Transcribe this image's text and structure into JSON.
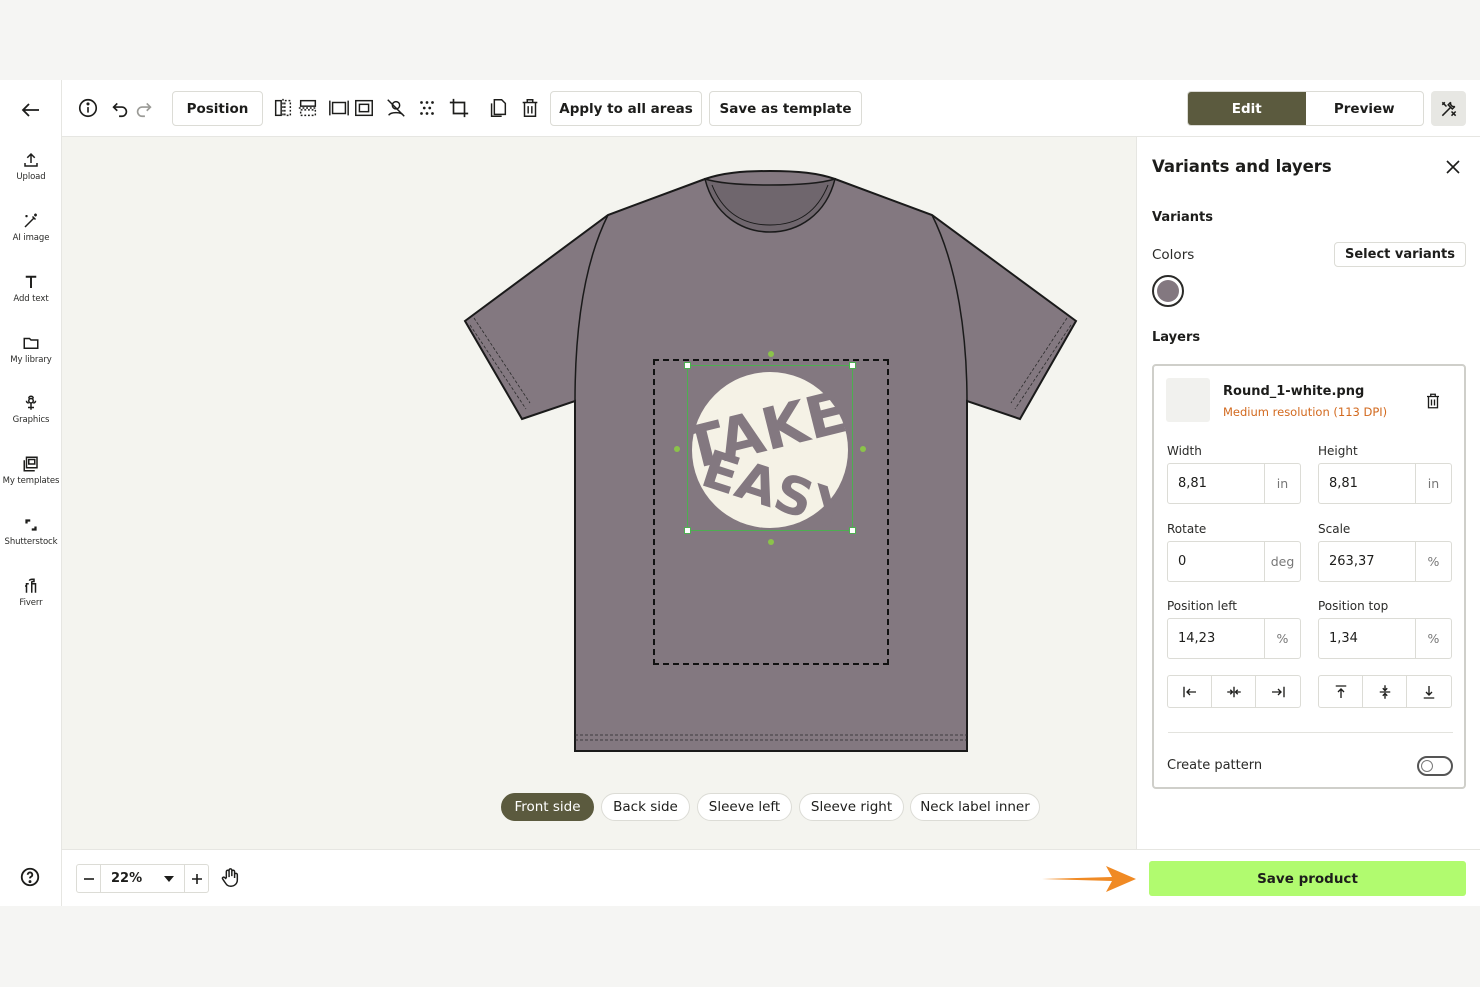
{
  "rail": {
    "items": [
      {
        "label": "Upload",
        "icon": "upload-icon"
      },
      {
        "label": "AI image",
        "icon": "magic-wand-icon"
      },
      {
        "label": "Add text",
        "icon": "text-icon"
      },
      {
        "label": "My library",
        "icon": "folder-icon"
      },
      {
        "label": "Graphics",
        "icon": "flower-icon"
      },
      {
        "label": "My templates",
        "icon": "templates-icon"
      },
      {
        "label": "Shutterstock",
        "icon": "shutterstock-icon"
      },
      {
        "label": "Fiverr",
        "icon": "fiverr-icon"
      }
    ]
  },
  "toolbar": {
    "position_label": "Position",
    "apply_all_label": "Apply to all areas",
    "save_template_label": "Save as template",
    "edit_label": "Edit",
    "preview_label": "Preview"
  },
  "canvas": {
    "shirt_color": "#837880",
    "sides": [
      "Front side",
      "Back side",
      "Sleeve left",
      "Sleeve right",
      "Neck label inner"
    ],
    "active_side": "Front side"
  },
  "panel": {
    "title": "Variants and layers",
    "variants_heading": "Variants",
    "colors_label": "Colors",
    "select_variants_label": "Select variants",
    "selected_color": "#837880",
    "layers_heading": "Layers",
    "layer": {
      "file_name": "Round_1-white.png",
      "resolution": "Medium resolution (113 DPI)",
      "width_label": "Width",
      "width_value": "8,81",
      "width_unit": "in",
      "height_label": "Height",
      "height_value": "8,81",
      "height_unit": "in",
      "rotate_label": "Rotate",
      "rotate_value": "0",
      "rotate_unit": "deg",
      "scale_label": "Scale",
      "scale_value": "263,37",
      "scale_unit": "%",
      "pos_left_label": "Position left",
      "pos_left_value": "14,23",
      "pos_left_unit": "%",
      "pos_top_label": "Position top",
      "pos_top_value": "1,34",
      "pos_top_unit": "%",
      "create_pattern_label": "Create pattern",
      "create_pattern_on": false
    }
  },
  "bottom": {
    "zoom": "22%",
    "save_label": "Save product",
    "accent_color": "#b1fb6f",
    "arrow_color": "#f08a24"
  }
}
